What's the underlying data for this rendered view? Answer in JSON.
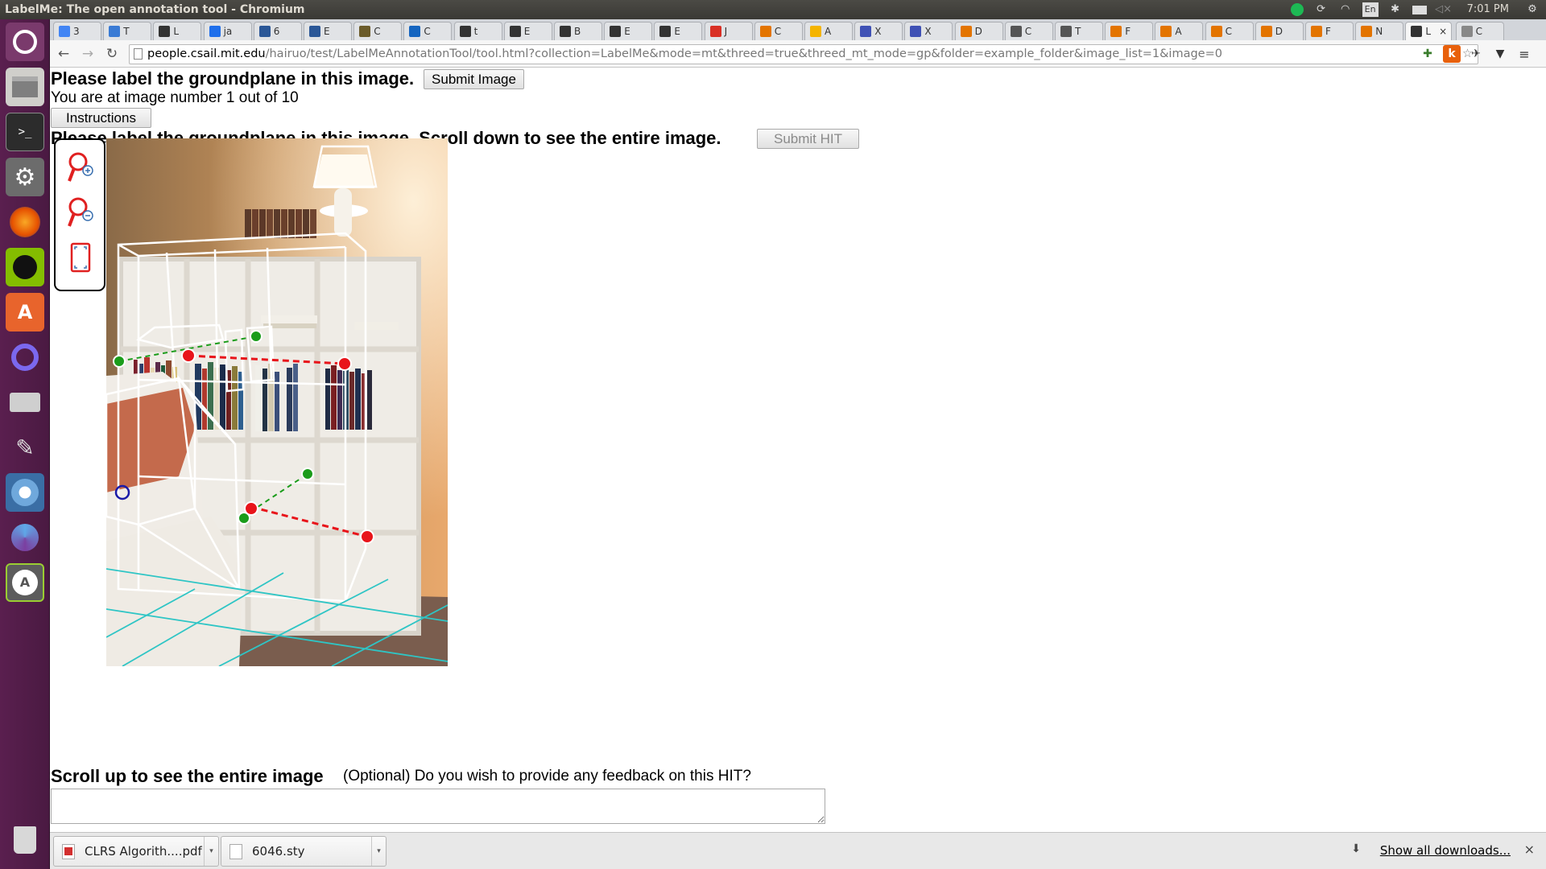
{
  "window": {
    "title": "LabelMe: The open annotation tool - Chromium"
  },
  "system_tray": {
    "keyboard": "En",
    "clock": "7:01 PM"
  },
  "tabs": [
    {
      "label": "3",
      "fav": "#4285f4"
    },
    {
      "label": "T",
      "fav": "#3a7bd5"
    },
    {
      "label": "L",
      "fav": "#333"
    },
    {
      "label": "ja",
      "fav": "#1f6feb"
    },
    {
      "label": "6",
      "fav": "#2b5797"
    },
    {
      "label": "E",
      "fav": "#2b5797"
    },
    {
      "label": "C",
      "fav": "#6b5b2a"
    },
    {
      "label": "C",
      "fav": "#1565c0"
    },
    {
      "label": "t",
      "fav": "#333"
    },
    {
      "label": "E",
      "fav": "#333"
    },
    {
      "label": "B",
      "fav": "#333"
    },
    {
      "label": "E",
      "fav": "#333"
    },
    {
      "label": "E",
      "fav": "#333"
    },
    {
      "label": "J",
      "fav": "#d93025"
    },
    {
      "label": "C",
      "fav": "#e37400"
    },
    {
      "label": "A",
      "fav": "#f4b400"
    },
    {
      "label": "X",
      "fav": "#3f51b5"
    },
    {
      "label": "X",
      "fav": "#3f51b5"
    },
    {
      "label": "D",
      "fav": "#e37400"
    },
    {
      "label": "C",
      "fav": "#555"
    },
    {
      "label": "T",
      "fav": "#555"
    },
    {
      "label": "F",
      "fav": "#e37400"
    },
    {
      "label": "A",
      "fav": "#e37400"
    },
    {
      "label": "C",
      "fav": "#e37400"
    },
    {
      "label": "D",
      "fav": "#e37400"
    },
    {
      "label": "F",
      "fav": "#e37400"
    },
    {
      "label": "N",
      "fav": "#e37400"
    },
    {
      "label": "L",
      "fav": "#333",
      "active": true
    },
    {
      "label": "C",
      "fav": "#888"
    }
  ],
  "address_bar": {
    "host": "people.csail.mit.edu",
    "path": "/hairuo/test/LabelMeAnnotationTool/tool.html?collection=LabelMe&mode=mt&threed=true&threed_mt_mode=gp&folder=example_folder&image_list=1&image=0"
  },
  "page": {
    "heading": "Please label the groundplane in this image.",
    "submit_image": "Submit Image",
    "image_counter": "You are at image number 1 out of 10",
    "instructions_button": "Instructions",
    "heading2": "Please label the groundplane in this image. Scroll down to see the entire image.",
    "submit_hit": "Submit HIT",
    "scroll_up": "Scroll up to see the entire image",
    "feedback_prompt": "(Optional) Do you wish to provide any feedback on this HIT?"
  },
  "downloads": {
    "items": [
      {
        "name": "CLRS Algorith....pdf",
        "type": "pdf"
      },
      {
        "name": "6046.sty",
        "type": "file"
      }
    ],
    "show_all": "Show all downloads...",
    "close": "×"
  }
}
